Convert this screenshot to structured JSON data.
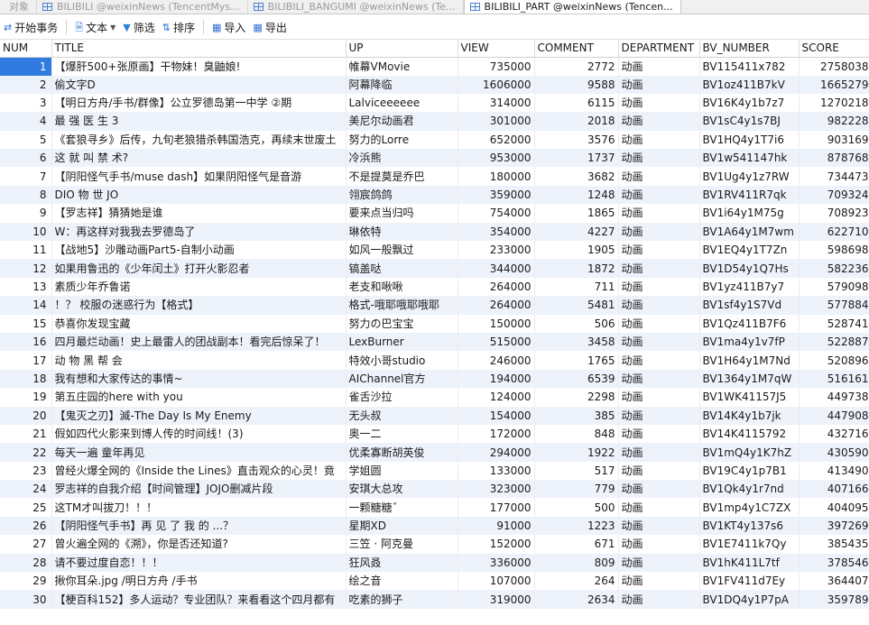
{
  "tabs": [
    {
      "label": "对象",
      "active": false
    },
    {
      "label": "BILIBILI @weixinNews (TencentMys...",
      "active": false
    },
    {
      "label": "BILIBILI_BANGUMI @weixinNews (Te...",
      "active": false
    },
    {
      "label": "BILIBILI_PART @weixinNews (Tencen...",
      "active": true
    }
  ],
  "toolbar": {
    "begin_tx": "开始事务",
    "text": "文本",
    "filter": "筛选",
    "sort": "排序",
    "import": "导入",
    "export": "导出"
  },
  "columns": [
    "NUM",
    "TITLE",
    "UP",
    "VIEW",
    "COMMENT",
    "DEPARTMENT",
    "BV_NUMBER",
    "SCORE"
  ],
  "rows": [
    {
      "num": "1",
      "title": "【爆肝500+张原画】干物妹！臭鼬娘!",
      "up": "帷幕VMovie",
      "view": "735000",
      "comment": "2772",
      "dep": "动画",
      "bv": "BV115411x782",
      "score": "2758038"
    },
    {
      "num": "2",
      "title": "偷文字D",
      "up": "阿幕降临",
      "view": "1606000",
      "comment": "9588",
      "dep": "动画",
      "bv": "BV1oz411B7kV",
      "score": "1665279"
    },
    {
      "num": "3",
      "title": "【明日方舟/手书/群像】公立罗德岛第一中学 ②期",
      "up": "Lalviceeeeee",
      "view": "314000",
      "comment": "6115",
      "dep": "动画",
      "bv": "BV16K4y1b7z7",
      "score": "1270218"
    },
    {
      "num": "4",
      "title": "最 强 医 生 3",
      "up": "美尼尔动画君",
      "view": "301000",
      "comment": "2018",
      "dep": "动画",
      "bv": "BV1sC4y1s7BJ",
      "score": "982228"
    },
    {
      "num": "5",
      "title": "《套狼寻乡》后传，九旬老狼猎杀韩国浩克，再续末世废土",
      "up": "努力的Lorre",
      "view": "652000",
      "comment": "3576",
      "dep": "动画",
      "bv": "BV1HQ4y1T7i6",
      "score": "903169"
    },
    {
      "num": "6",
      "title": "这 就 叫 禁 术?",
      "up": "冷浜熊",
      "view": "953000",
      "comment": "1737",
      "dep": "动画",
      "bv": "BV1w541147hk",
      "score": "878768"
    },
    {
      "num": "7",
      "title": "【阴阳怪气手书/muse dash】如果阴阳怪气是音游",
      "up": "不是提莫是乔巴",
      "view": "180000",
      "comment": "3682",
      "dep": "动画",
      "bv": "BV1Ug4y1z7RW",
      "score": "734473"
    },
    {
      "num": "8",
      "title": "DIO 物 世 JO",
      "up": "翎宸鸽鸽",
      "view": "359000",
      "comment": "1248",
      "dep": "动画",
      "bv": "BV1RV411R7qk",
      "score": "709324"
    },
    {
      "num": "9",
      "title": "【罗志祥】猜猜她是谁",
      "up": "要来点当归吗",
      "view": "754000",
      "comment": "1865",
      "dep": "动画",
      "bv": "BV1i64y1M75g",
      "score": "708923"
    },
    {
      "num": "10",
      "title": "W：再这样对我我去罗德岛了",
      "up": "琳依特",
      "view": "354000",
      "comment": "4227",
      "dep": "动画",
      "bv": "BV1A64y1M7wm",
      "score": "622710"
    },
    {
      "num": "11",
      "title": "【战地5】沙雕动画Part5-自制小动画",
      "up": "如风一般飘过",
      "view": "233000",
      "comment": "1905",
      "dep": "动画",
      "bv": "BV1EQ4y1T7Zn",
      "score": "598698"
    },
    {
      "num": "12",
      "title": "如果用鲁迅的《少年闰土》打开火影忍者",
      "up": "镐盖哒",
      "view": "344000",
      "comment": "1872",
      "dep": "动画",
      "bv": "BV1D54y1Q7Hs",
      "score": "582236"
    },
    {
      "num": "13",
      "title": "素质少年乔鲁诺",
      "up": "老支和啾啾",
      "view": "264000",
      "comment": "711",
      "dep": "动画",
      "bv": "BV1yz411B7y7",
      "score": "579098"
    },
    {
      "num": "14",
      "title": "！？ 校服の迷惑行为【格式】",
      "up": "格式-哦耶哦耶哦耶",
      "view": "264000",
      "comment": "5481",
      "dep": "动画",
      "bv": "BV1sf4y1S7Vd",
      "score": "577884"
    },
    {
      "num": "15",
      "title": "恭喜你发现宝藏",
      "up": "努力の巴宝宝",
      "view": "150000",
      "comment": "506",
      "dep": "动画",
      "bv": "BV1Qz411B7F6",
      "score": "528741"
    },
    {
      "num": "16",
      "title": "四月最烂动画！史上最雷人的团战副本！看完后惊呆了！",
      "up": "LexBurner",
      "view": "515000",
      "comment": "3458",
      "dep": "动画",
      "bv": "BV1ma4y1v7fP",
      "score": "522887"
    },
    {
      "num": "17",
      "title": "动 物 黑 帮 会",
      "up": "特效小哥studio",
      "view": "246000",
      "comment": "1765",
      "dep": "动画",
      "bv": "BV1H64y1M7Nd",
      "score": "520896"
    },
    {
      "num": "18",
      "title": "我有想和大家传达的事情~",
      "up": "AIChannel官方",
      "view": "194000",
      "comment": "6539",
      "dep": "动画",
      "bv": "BV1364y1M7qW",
      "score": "516161"
    },
    {
      "num": "19",
      "title": "第五庄园的here with you",
      "up": "雀舌沙拉",
      "view": "124000",
      "comment": "2298",
      "dep": "动画",
      "bv": "BV1WK41157J5",
      "score": "449738"
    },
    {
      "num": "20",
      "title": "【鬼灭之刃】滅-The Day Is My Enemy",
      "up": "无头叔",
      "view": "154000",
      "comment": "385",
      "dep": "动画",
      "bv": "BV14K4y1b7jk",
      "score": "447908"
    },
    {
      "num": "21",
      "title": "假如四代火影来到博人传的时间线！(3)",
      "up": "奥一二",
      "view": "172000",
      "comment": "848",
      "dep": "动画",
      "bv": "BV14K4115792",
      "score": "432716"
    },
    {
      "num": "22",
      "title": "每天一遍 童年再见",
      "up": "优柔寡断胡英俊",
      "view": "294000",
      "comment": "1922",
      "dep": "动画",
      "bv": "BV1mQ4y1K7hZ",
      "score": "430590"
    },
    {
      "num": "23",
      "title": "曾经火爆全网的《Inside the Lines》直击观众的心灵！竟",
      "up": "学姐圆",
      "view": "133000",
      "comment": "517",
      "dep": "动画",
      "bv": "BV19C4y1p7B1",
      "score": "413490"
    },
    {
      "num": "24",
      "title": "罗志祥的自我介绍【时间管理】JOJO删减片段",
      "up": "安琪大总攻",
      "view": "323000",
      "comment": "779",
      "dep": "动画",
      "bv": "BV1Qk4y1r7nd",
      "score": "407166"
    },
    {
      "num": "25",
      "title": "这TM才叫拔刀！！！",
      "up": "一颗糖糖ˇ",
      "view": "177000",
      "comment": "500",
      "dep": "动画",
      "bv": "BV1mp4y1C7ZX",
      "score": "404095"
    },
    {
      "num": "26",
      "title": "【阴阳怪气手书】再 见 了 我 的 ...？",
      "up": "星期XD",
      "view": "91000",
      "comment": "1223",
      "dep": "动画",
      "bv": "BV1KT4y137s6",
      "score": "397269"
    },
    {
      "num": "27",
      "title": "曾火遍全网的《溯》，你是否还知道?",
      "up": "三笠 · 阿克曼",
      "view": "152000",
      "comment": "671",
      "dep": "动画",
      "bv": "BV1E7411k7Qy",
      "score": "385435"
    },
    {
      "num": "28",
      "title": "请不要过度自恋！！！",
      "up": "狂风叒",
      "view": "336000",
      "comment": "809",
      "dep": "动画",
      "bv": "BV1hK411L7tf",
      "score": "378546"
    },
    {
      "num": "29",
      "title": "揪你耳朵.jpg /明日方舟 /手书",
      "up": "绘之音",
      "view": "107000",
      "comment": "264",
      "dep": "动画",
      "bv": "BV1FV411d7Ey",
      "score": "364407"
    },
    {
      "num": "30",
      "title": "【梗百科152】多人运动？专业团队？来看看这个四月都有",
      "up": "吃素的狮子",
      "view": "319000",
      "comment": "2634",
      "dep": "动画",
      "bv": "BV1DQ4y1P7pA",
      "score": "359789"
    }
  ]
}
